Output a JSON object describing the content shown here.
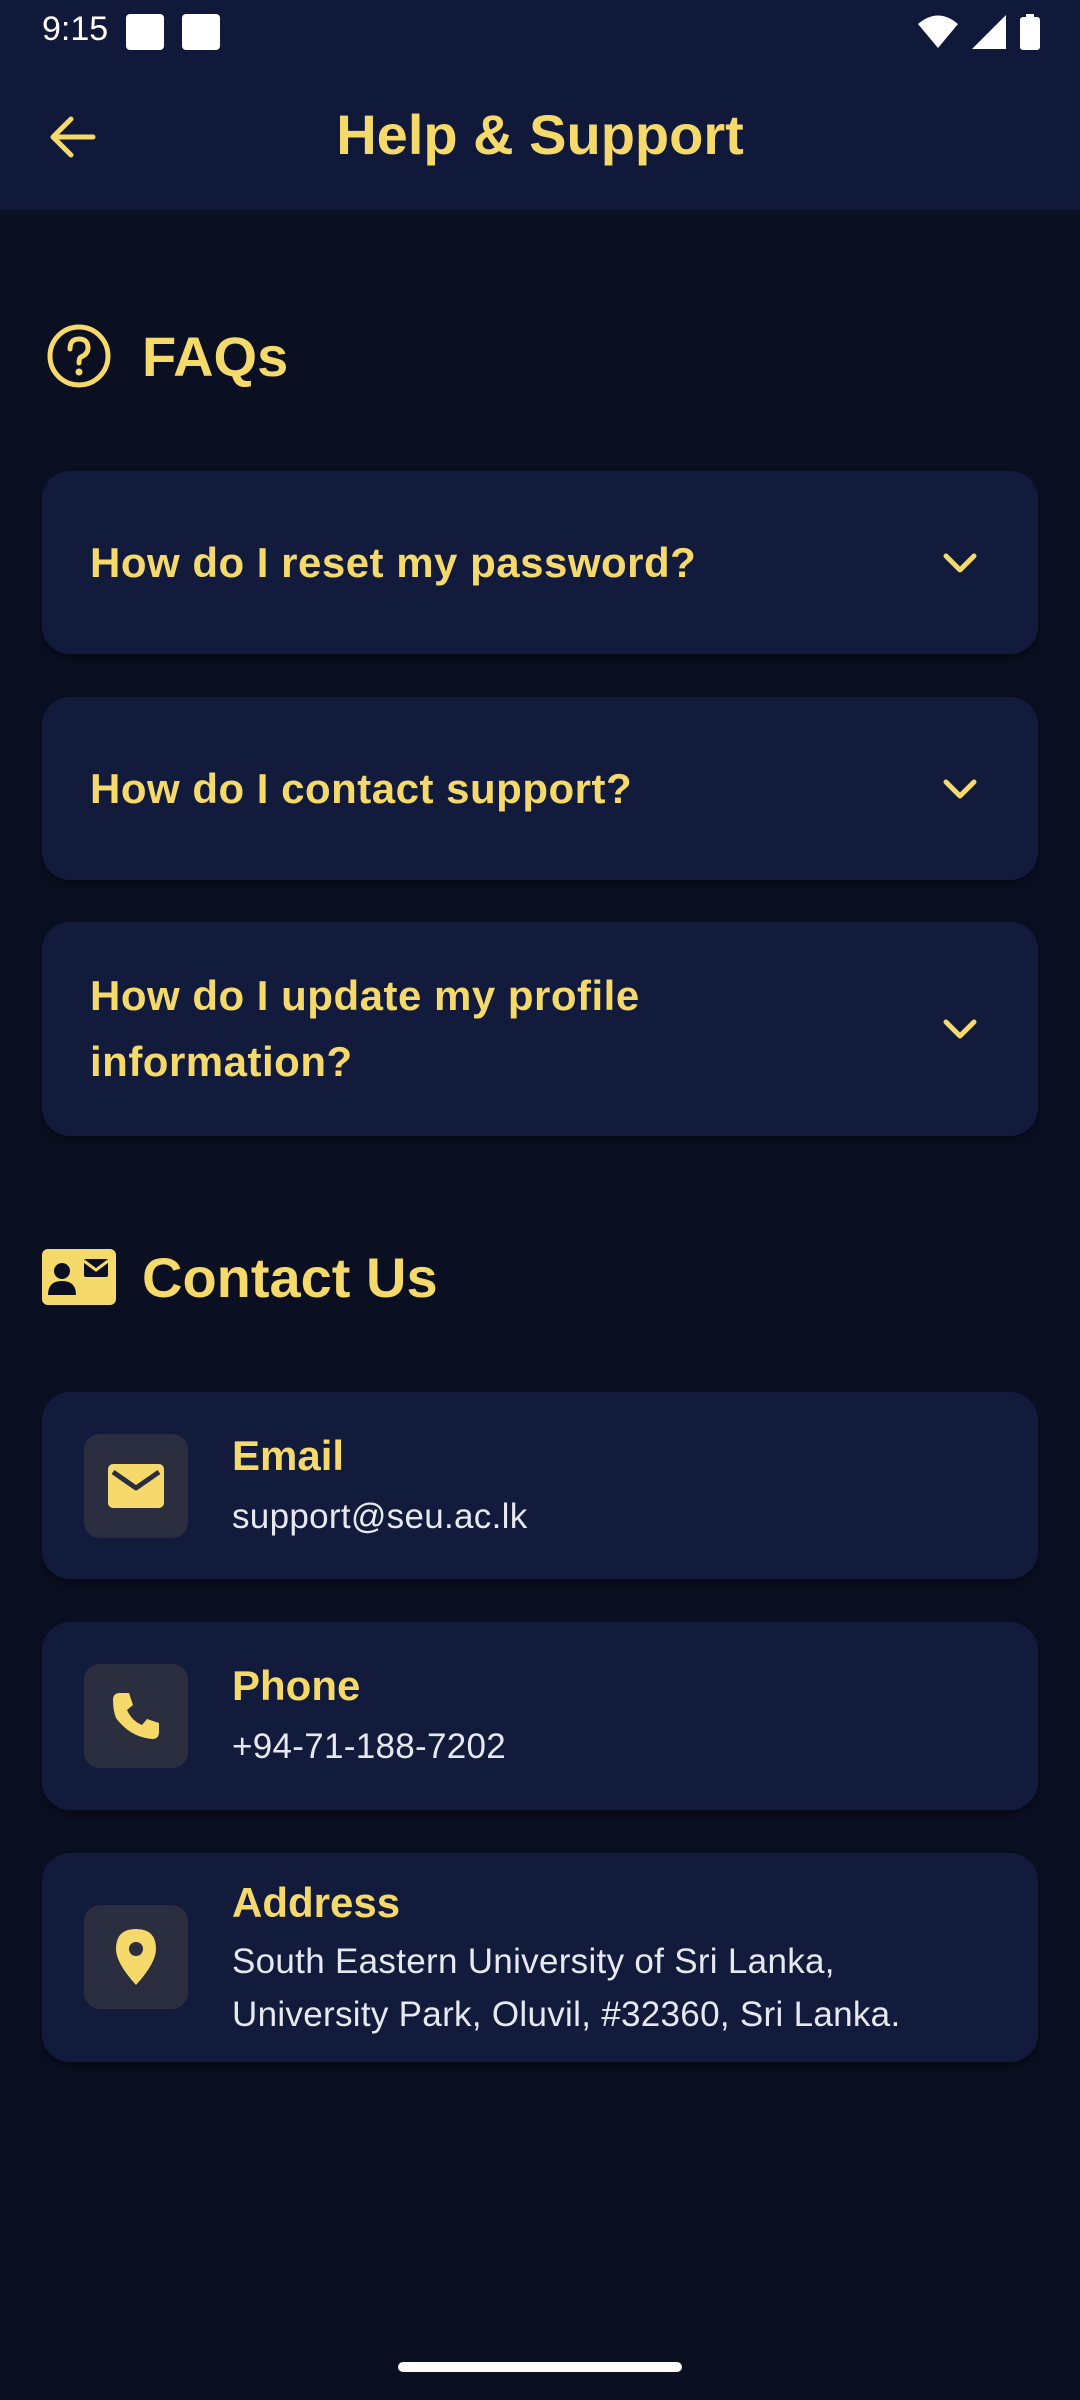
{
  "status_bar": {
    "time": "9:15"
  },
  "app_bar": {
    "title": "Help & Support"
  },
  "faq_section": {
    "title": "FAQs",
    "items": [
      {
        "question": "How do I reset my password?"
      },
      {
        "question": "How do I contact support?"
      },
      {
        "question": "How do I update my profile information?"
      }
    ]
  },
  "contact_section": {
    "title": "Contact Us",
    "items": [
      {
        "label": "Email",
        "value": "support@seu.ac.lk",
        "icon": "mail-icon"
      },
      {
        "label": "Phone",
        "value": "+94-71-188-7202",
        "icon": "phone-icon"
      },
      {
        "label": "Address",
        "value": "South Eastern University of Sri Lanka, University Park, Oluvil, #32360, Sri Lanka.",
        "icon": "location-pin-icon"
      }
    ]
  },
  "colors": {
    "accent": "#f6d96b",
    "background": "#0a0f22",
    "card": "#121b3b",
    "app_bar": "#101939"
  }
}
